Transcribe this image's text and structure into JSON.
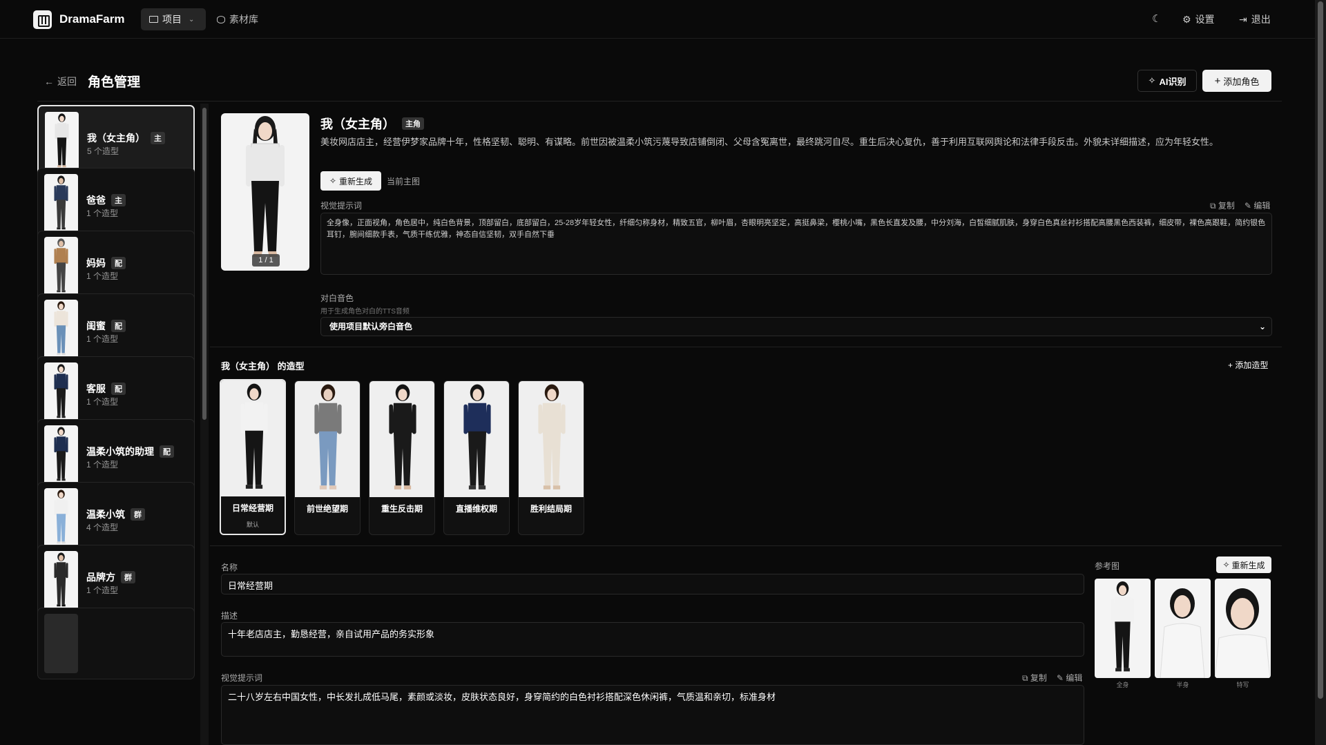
{
  "app": {
    "brand": "DramaFarm"
  },
  "nav": {
    "projects": "项目",
    "library": "素材库",
    "settings": "设置",
    "logout": "退出"
  },
  "header": {
    "back": "返回",
    "title": "角色管理",
    "ai_btn": "AI识别",
    "add_btn": "添加角色"
  },
  "characters": [
    {
      "name": "我（女主角）",
      "badge": "主",
      "count": "5 个造型"
    },
    {
      "name": "爸爸",
      "badge": "主",
      "count": "1 个造型"
    },
    {
      "name": "妈妈",
      "badge": "配",
      "count": "1 个造型"
    },
    {
      "name": "闺蜜",
      "badge": "配",
      "count": "1 个造型"
    },
    {
      "name": "客服",
      "badge": "配",
      "count": "1 个造型"
    },
    {
      "name": "温柔小筑的助理",
      "badge": "配",
      "count": "1 个造型"
    },
    {
      "name": "温柔小筑",
      "badge": "群",
      "count": "4 个造型"
    },
    {
      "name": "品牌方",
      "badge": "群",
      "count": "1 个造型"
    }
  ],
  "detail": {
    "name": "我（女主角）",
    "badge": "主角",
    "description": "美妆网店店主，经营伊梦家品牌十年，性格坚韧、聪明、有谋略。前世因被温柔小筑污蔑导致店铺倒闭、父母含冤离世，最终跳河自尽。重生后决心复仇，善于利用互联网舆论和法律手段反击。外貌未详细描述，应为年轻女性。",
    "image_counter": "1 / 1",
    "regen_btn": "重新生成",
    "current_main": "当前主图",
    "visual_prompt_label": "视觉提示词",
    "copy": "复制",
    "edit": "编辑",
    "visual_prompt": "全身像，正面视角，角色居中，纯白色背景，顶部留白，底部留白，25-28岁年轻女性，纤细匀称身材，精致五官，柳叶眉，杏眼明亮坚定，高挺鼻梁，樱桃小嘴，黑色长直发及腰，中分刘海，白皙细腻肌肤，身穿白色真丝衬衫搭配高腰黑色西装裤，细皮带，裸色高跟鞋，简约银色耳钉，腕间细款手表，气质干练优雅，神态自信坚韧，双手自然下垂",
    "voice_label": "对白音色",
    "voice_hint": "用于生成角色对白的TTS音频",
    "voice_value": "使用项目默认旁白音色"
  },
  "looks": {
    "title": "我（女主角） 的造型",
    "add": "添加造型",
    "items": [
      {
        "name": "日常经营期",
        "sub": "默认"
      },
      {
        "name": "前世绝望期",
        "sub": ""
      },
      {
        "name": "重生反击期",
        "sub": ""
      },
      {
        "name": "直播维权期",
        "sub": ""
      },
      {
        "name": "胜利结局期",
        "sub": ""
      }
    ]
  },
  "look_detail": {
    "name_label": "名称",
    "name_value": "日常经营期",
    "desc_label": "描述",
    "desc_value": "十年老店店主，勤恳经营，亲自试用产品的务实形象",
    "prompt_label": "视觉提示词",
    "copy": "复制",
    "edit": "编辑",
    "prompt_value": "二十八岁左右中国女性，中长发扎成低马尾，素颜或淡妆，皮肤状态良好，身穿简约的白色衬衫搭配深色休闲裤，气质温和亲切，标准身材",
    "ref_label": "参考图",
    "regen_btn": "重新生成",
    "refs": [
      "全身",
      "半身",
      "特写"
    ]
  }
}
